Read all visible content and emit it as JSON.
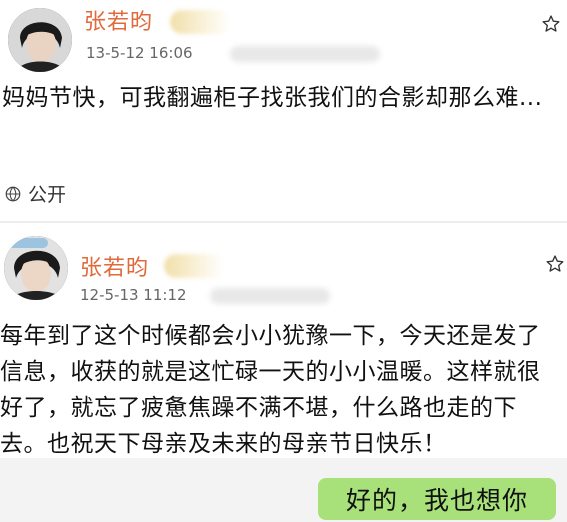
{
  "posts": [
    {
      "author": "张若昀",
      "timestamp": "13-5-12 16:06",
      "content": "妈妈节快，可我翻遍柜子找张我们的合影却那么难...",
      "visibility": "公开"
    },
    {
      "author": "张若昀",
      "timestamp": "12-5-13 11:12",
      "content": "每年到了这个时候都会小小犹豫一下，今天还是发了信息，收获的就是这忙碌一天的小小温暖。这样就很好了，就忘了疲惫焦躁不满不堪，什么路也走的下去。也祝天下母亲及未来的母亲节日快乐！"
    }
  ],
  "reply": {
    "text": "好的，我也想你"
  },
  "colors": {
    "author": "#e06a3b",
    "reply_bubble": "#a8e07a"
  },
  "icons": {
    "favorite": "star-outline-icon",
    "visibility": "globe-icon"
  }
}
